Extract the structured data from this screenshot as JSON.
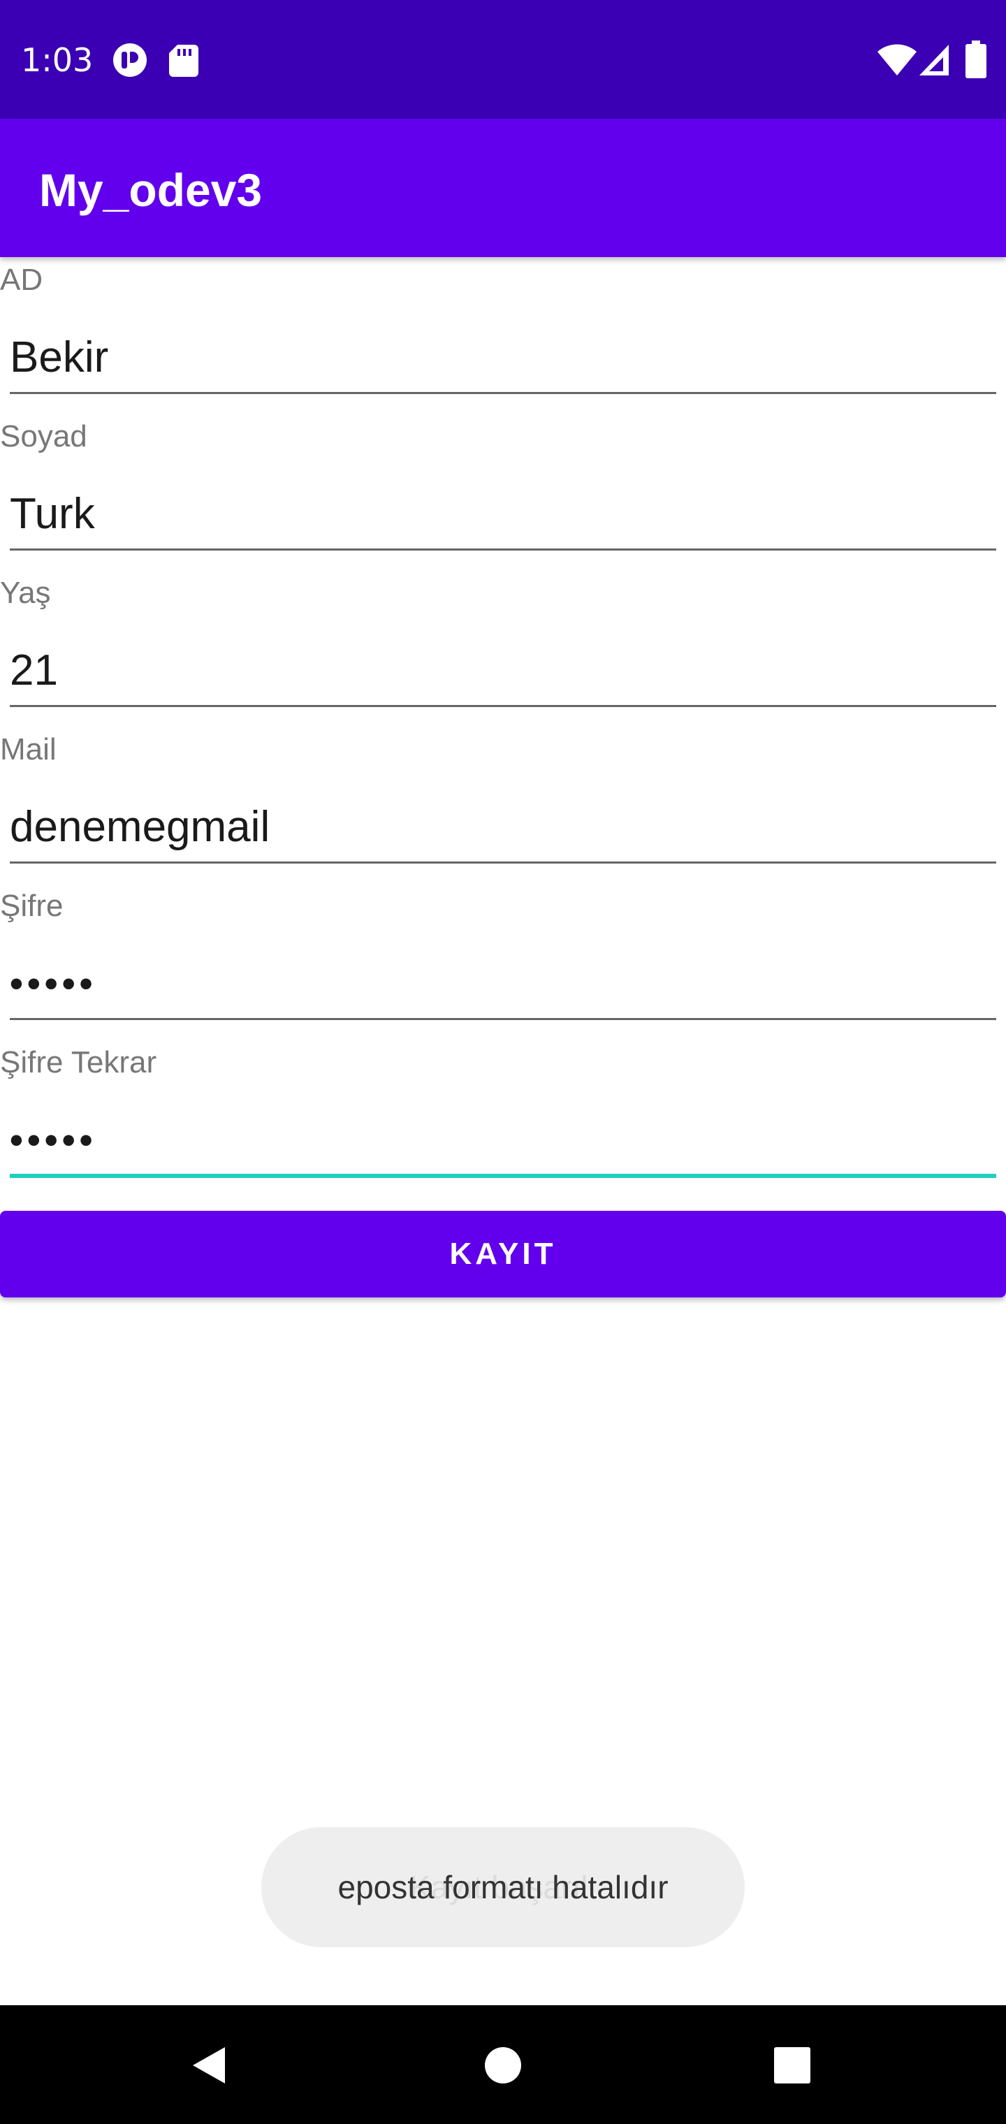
{
  "status_bar": {
    "time": "1:03",
    "icons": [
      "notification-app-icon",
      "sd-card-icon",
      "wifi-icon",
      "cellular-signal-icon",
      "battery-icon"
    ]
  },
  "app_bar": {
    "title": "My_odev3"
  },
  "form": {
    "ad": {
      "label": "AD",
      "value": "Bekir"
    },
    "soyad": {
      "label": "Soyad",
      "value": "Turk"
    },
    "yas": {
      "label": "Yaş",
      "value": "21"
    },
    "mail": {
      "label": "Mail",
      "value": "denemegmail"
    },
    "sifre": {
      "label": "Şifre",
      "value": "•••••"
    },
    "sifre_tekrar": {
      "label": "Şifre Tekrar",
      "value": "•••••"
    },
    "submit_label": "KAYIT"
  },
  "toast": {
    "message": "eposta formatı hatalıdır",
    "ghost_message": "Kayıt başarılı"
  },
  "nav_bar": {
    "buttons": [
      "back-icon",
      "home-icon",
      "recents-icon"
    ]
  },
  "colors": {
    "status_bar": "#3c00b4",
    "primary": "#6200ee",
    "focus_underline": "#1ecfc1",
    "toast_bg": "#eeeeee"
  }
}
